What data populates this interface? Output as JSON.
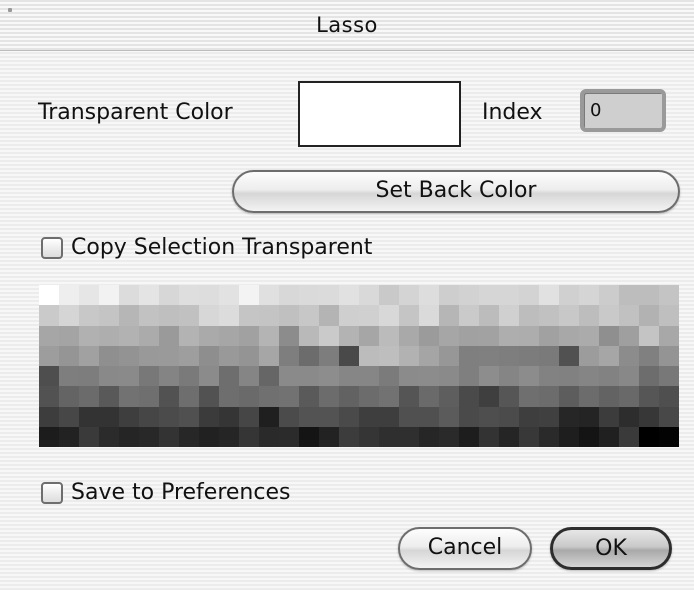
{
  "window": {
    "title": "Lasso"
  },
  "transparent_color": {
    "label": "Transparent Color",
    "swatch_color": "#ffffff"
  },
  "index": {
    "label": "Index",
    "value": "0"
  },
  "buttons": {
    "set_back_color": "Set Back Color",
    "cancel": "Cancel",
    "ok": "OK"
  },
  "checkboxes": {
    "copy_selection_transparent": {
      "label": "Copy Selection Transparent",
      "checked": false
    },
    "save_to_preferences": {
      "label": "Save to Preferences",
      "checked": false
    }
  },
  "palette": {
    "columns": 32,
    "rows": [
      [
        "#ffffff",
        "#eeeeee",
        "#e6e6e6",
        "#f2f2f2",
        "#dcdcdc",
        "#e4e4e4",
        "#d7d7d7",
        "#dedede",
        "#dddddd",
        "#e2e2e2",
        "#f3f3f3",
        "#e0e0e0",
        "#d8d8d8",
        "#dadada",
        "#dbdbdb",
        "#e1e1e1",
        "#d9d9d9",
        "#c9c9c9",
        "#d4d4d4",
        "#dddddd",
        "#cecece",
        "#d2d2d2",
        "#d6d6d6",
        "#d6d6d6",
        "#d3d3d3",
        "#e1e1e1",
        "#d0d0d0",
        "#d5d5d5",
        "#cccccc",
        "#bdbdbd",
        "#bdbdbd",
        "#c4c4c4"
      ],
      [
        "#cacaca",
        "#d5d5d5",
        "#c8c8c8",
        "#c4c4c4",
        "#b6b6b6",
        "#c2c2c2",
        "#bfbfbf",
        "#c1c1c1",
        "#d7d7d7",
        "#dcdcdc",
        "#c5c5c5",
        "#c4c4c4",
        "#c0c0c0",
        "#c7c7c7",
        "#b4b4b4",
        "#cfcfcf",
        "#d0d0d0",
        "#d8d8d8",
        "#c5c5c5",
        "#dadada",
        "#b6b6b6",
        "#cacaca",
        "#bcbcbc",
        "#d0d0d0",
        "#bdbdbd",
        "#c1c1c1",
        "#c8c8c8",
        "#bdbdbd",
        "#c9c9c9",
        "#c1c1c1",
        "#b2b2b2",
        "#bfbfbf"
      ],
      [
        "#a6a6a6",
        "#a4a4a4",
        "#b1b1b1",
        "#aeaeae",
        "#b2b2b2",
        "#ababab",
        "#9a9a9a",
        "#b3b3b3",
        "#aaaaaa",
        "#a6a6a6",
        "#a1a1a1",
        "#b4b4b4",
        "#8c8c8c",
        "#b9b9b9",
        "#cacaca",
        "#b3b3b3",
        "#a6a6a6",
        "#bbbbbb",
        "#a9a9a9",
        "#9b9b9b",
        "#a6a6a6",
        "#a1a1a1",
        "#a2a2a2",
        "#aeaeae",
        "#adadad",
        "#a1a1a1",
        "#a8a8a8",
        "#ababab",
        "#8f8f8f",
        "#9f9f9f",
        "#c4c4c4",
        "#a8a8a8"
      ],
      [
        "#9d9d9d",
        "#959595",
        "#a1a1a1",
        "#8f8f8f",
        "#939393",
        "#999999",
        "#9a9a9a",
        "#9e9e9e",
        "#8e8e8e",
        "#999999",
        "#949494",
        "#a6a6a6",
        "#7e7e7e",
        "#6c6c6c",
        "#7d7d7d",
        "#494949",
        "#bcbcbc",
        "#bebebe",
        "#b2b2b2",
        "#a5a5a5",
        "#979797",
        "#7f7f7f",
        "#808080",
        "#7e7e7e",
        "#7c7c7c",
        "#7a7a7a",
        "#515151",
        "#9c9c9c",
        "#a6a6a6",
        "#8c8c8c",
        "#808080",
        "#949494"
      ],
      [
        "#4e4e4e",
        "#7e7e7e",
        "#7d7d7d",
        "#898989",
        "#8a8a8a",
        "#787878",
        "#848484",
        "#7a7a7a",
        "#8b8b8b",
        "#6e6e6e",
        "#858585",
        "#666666",
        "#8a8a8a",
        "#8a8a8a",
        "#8d8d8d",
        "#868686",
        "#868686",
        "#7b7b7b",
        "#8b8b8b",
        "#8c8c8c",
        "#8a8a8a",
        "#7f7f7f",
        "#8d8d8d",
        "#858585",
        "#8c8c8c",
        "#828282",
        "#818181",
        "#858585",
        "#828282",
        "#888888",
        "#6d6d6d",
        "#787878"
      ],
      [
        "#525252",
        "#646464",
        "#6b6b6b",
        "#595959",
        "#727272",
        "#6f6f6f",
        "#525252",
        "#6e6e6e",
        "#525252",
        "#6e6e6e",
        "#6a6a6a",
        "#707070",
        "#727272",
        "#5a5a5a",
        "#6c6c6c",
        "#626262",
        "#6c6c6c",
        "#727272",
        "#555555",
        "#6a6a6a",
        "#5e5e5e",
        "#4a4a4a",
        "#3f3f3f",
        "#565656",
        "#6f6f6f",
        "#6c6c6c",
        "#5d5d5d",
        "#6c6c6c",
        "#636363",
        "#696969",
        "#565656",
        "#4f4f4f"
      ],
      [
        "#3d3d3d",
        "#474747",
        "#333333",
        "#333333",
        "#3e3e3e",
        "#464646",
        "#4b4b4b",
        "#505050",
        "#3b3b3b",
        "#353535",
        "#464646",
        "#1f1f1f",
        "#4b4b4b",
        "#535353",
        "#535353",
        "#4a4a4a",
        "#3e3e3e",
        "#3e3e3e",
        "#505050",
        "#505050",
        "#5b5b5b",
        "#4a4a4a",
        "#4e4e4e",
        "#4b4b4b",
        "#3e3e3e",
        "#404040",
        "#262626",
        "#242424",
        "#3c3c3c",
        "#2d2d2d",
        "#373737",
        "#484848"
      ],
      [
        "#1c1c1c",
        "#222222",
        "#3a3a3a",
        "#2b2b2b",
        "#252525",
        "#282828",
        "#333333",
        "#272727",
        "#212121",
        "#252525",
        "#353535",
        "#2a2a2a",
        "#2b2b2b",
        "#141414",
        "#222222",
        "#3c3c3c",
        "#353535",
        "#2f2f2f",
        "#2f2f2f",
        "#262626",
        "#2a2a2a",
        "#1d1d1d",
        "#333333",
        "#252525",
        "#383838",
        "#2a2a2a",
        "#1e1e1e",
        "#141414",
        "#202020",
        "#3a3a3a",
        "#000000",
        "#030303"
      ]
    ]
  }
}
